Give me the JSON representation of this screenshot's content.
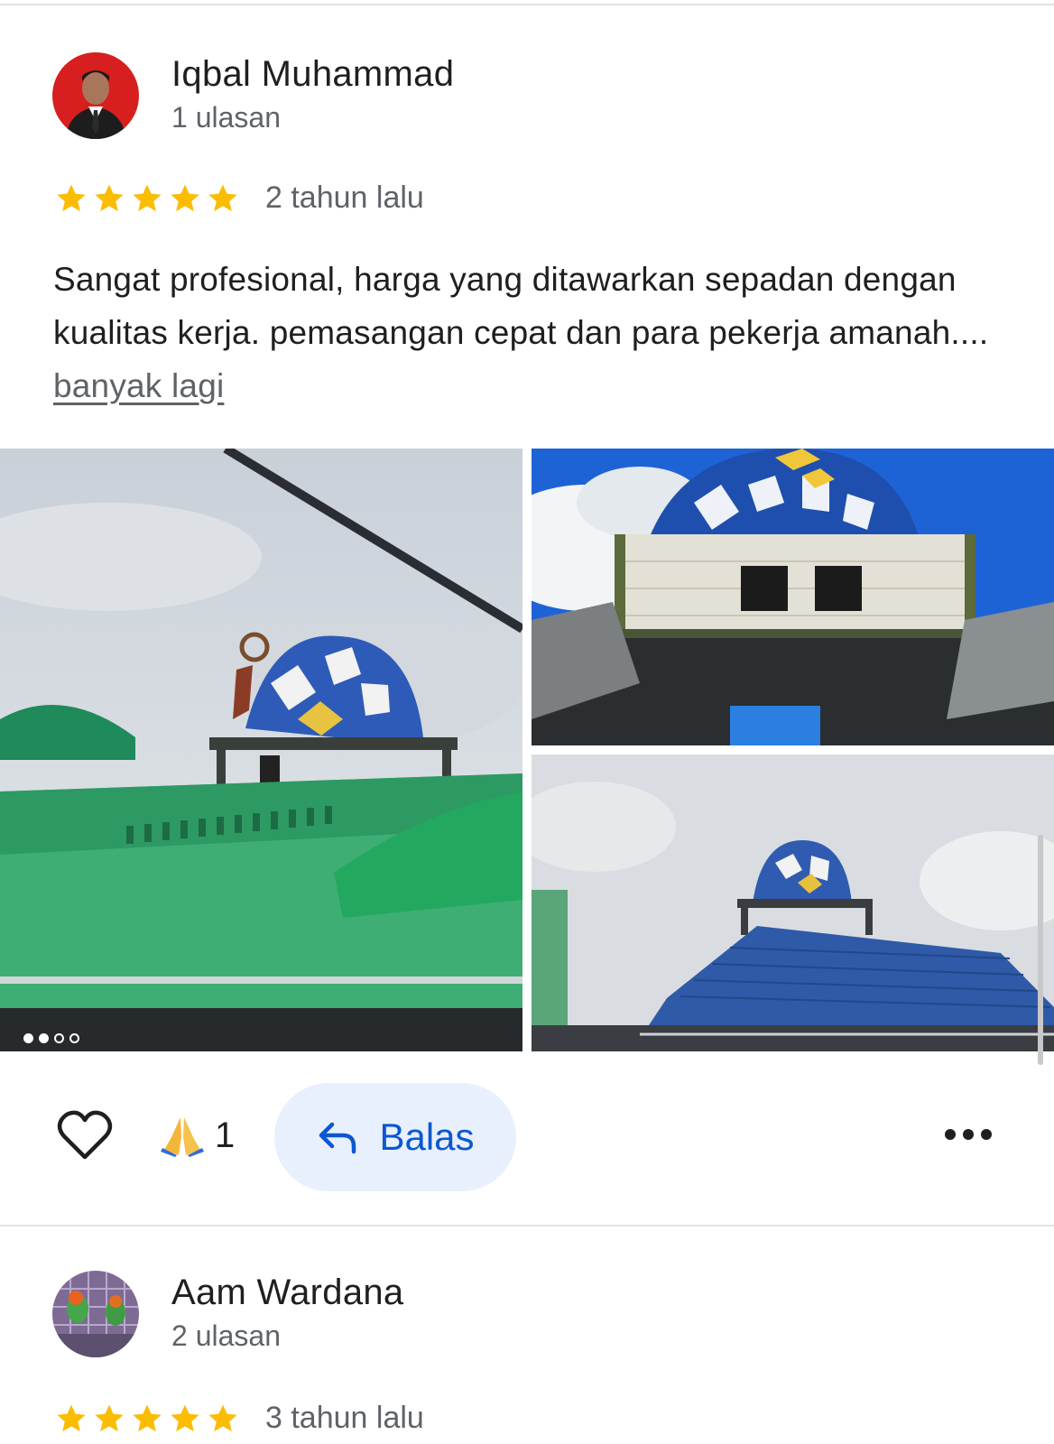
{
  "reviews": [
    {
      "author": "Iqbal Muhammad",
      "review_count": "1 ulasan",
      "rating": 5,
      "time": "2 tahun lalu",
      "text": "Sangat profesional, harga yang ditawarkan sepadan dengan kualitas kerja. pemasangan cepat dan para pekerja amanah....",
      "more_label": "banyak lagi",
      "photo_count_dots": 4,
      "active_dot": 1,
      "reaction_emoji": "🙏",
      "reaction_count": "1",
      "reply_label": "Balas"
    },
    {
      "author": "Aam Wardana",
      "review_count": "2 ulasan",
      "rating": 5,
      "time": "3 tahun lalu"
    }
  ],
  "icons": {
    "star": "star-icon",
    "like": "heart-outline-icon",
    "reply": "reply-arrow-icon",
    "more": "more-horizontal-icon",
    "reaction": "folded-hands-emoji"
  },
  "colors": {
    "star": "#fbbc04",
    "link_accent": "#0b57d0",
    "reply_bg": "#e9f0fd",
    "secondary_text": "#5f6368"
  }
}
